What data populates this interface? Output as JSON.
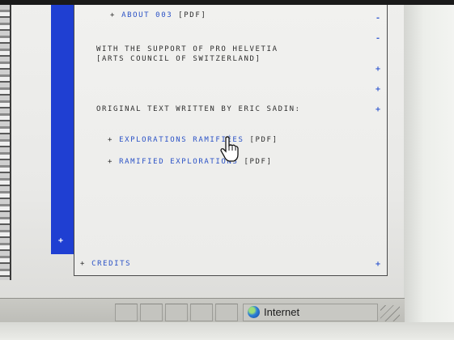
{
  "links": {
    "about": {
      "prefix": "+",
      "label": "ABOUT 003",
      "suffix": "[PDF]"
    },
    "explorations_ramifiees": {
      "prefix": "+",
      "label": "EXPLORATIONS RAMIFIÉES",
      "suffix": "[PDF]"
    },
    "ramified_explorations": {
      "prefix": "+",
      "label": "RAMIFIED EXPLORATIONS",
      "suffix": "[PDF]"
    },
    "credits": {
      "prefix": "+",
      "label": "CREDITS"
    }
  },
  "text": {
    "support_line1": "WITH THE SUPPORT OF PRO HELVETIA",
    "support_line2": "[ARTS COUNCIL OF SWITZERLAND]",
    "original_text": "ORIGINAL TEXT WRITTEN BY ERIC SADIN:"
  },
  "side_marks": [
    "-",
    "-",
    "+",
    "+",
    "+",
    "+"
  ],
  "blue_bar_mark": "+",
  "status_bar": {
    "zone_label": "Internet",
    "zone_icon": "globe-icon"
  },
  "colors": {
    "link": "#2b52c6",
    "blue_bar": "#1f3fd2",
    "text": "#2d2d2d"
  }
}
